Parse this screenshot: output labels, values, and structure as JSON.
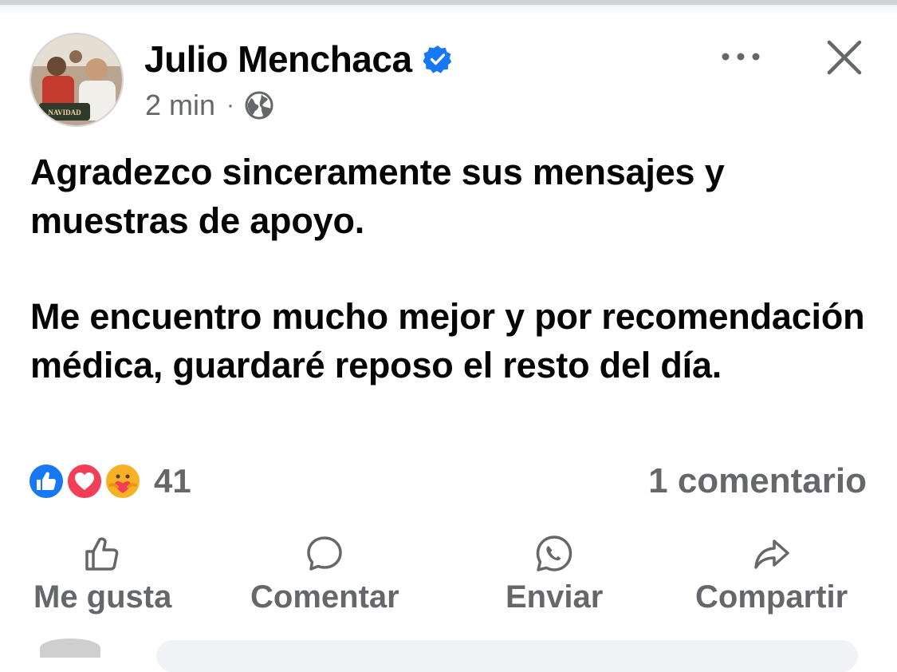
{
  "post": {
    "author": "Julio Menchaca",
    "verified": true,
    "time": "2 min",
    "separator": "·",
    "audience_icon": "globe-icon",
    "avatar_badge": "NAVIDAD",
    "paragraphs": [
      "Agradezco sinceramente sus mensajes y muestras de apoyo.",
      "Me encuentro mucho mejor y por recomendación médica, guardaré reposo el resto del día."
    ]
  },
  "header_buttons": {
    "more_icon": "more-horizontal-icon",
    "close_icon": "close-icon"
  },
  "reactions": {
    "icons": [
      "like-reaction-icon",
      "love-reaction-icon",
      "care-reaction-icon"
    ],
    "count": "41"
  },
  "comments": {
    "count_text": "1 comentario"
  },
  "actions": [
    {
      "icon": "thumbs-up-icon",
      "label": "Me gusta"
    },
    {
      "icon": "comment-bubble-icon",
      "label": "Comentar"
    },
    {
      "icon": "whatsapp-icon",
      "label": "Enviar"
    },
    {
      "icon": "share-arrow-icon",
      "label": "Compartir"
    }
  ],
  "colors": {
    "accent": "#1877f2",
    "text": "#050505",
    "muted": "#65676b",
    "love": "#f33e58",
    "care": "#f7b125"
  }
}
